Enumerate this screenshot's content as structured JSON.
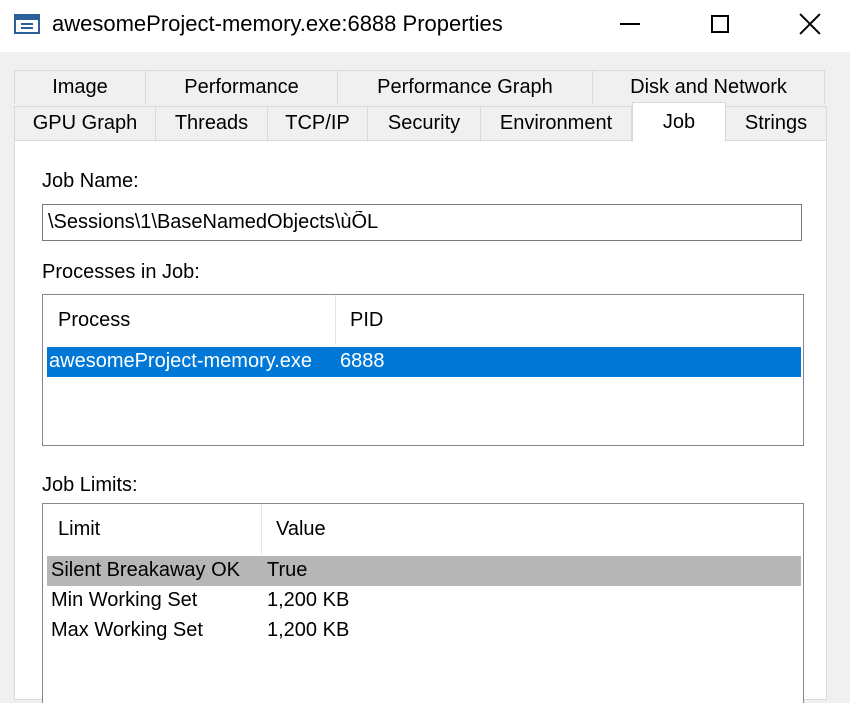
{
  "window": {
    "title": "awesomeProject-memory.exe:6888 Properties",
    "icon": "window-app-icon"
  },
  "tabs": {
    "row1": [
      {
        "label": "Image"
      },
      {
        "label": "Performance"
      },
      {
        "label": "Performance Graph"
      },
      {
        "label": "Disk and Network"
      }
    ],
    "row2": [
      {
        "label": "GPU Graph"
      },
      {
        "label": "Threads"
      },
      {
        "label": "TCP/IP"
      },
      {
        "label": "Security"
      },
      {
        "label": "Environment"
      },
      {
        "label": "Job",
        "active": true
      },
      {
        "label": "Strings"
      }
    ]
  },
  "job": {
    "name_label": "Job Name:",
    "name_value": "\\Sessions\\1\\BaseNamedObjects\\ùÕL",
    "processes_label": "Processes in Job:",
    "processes_columns": [
      "Process",
      "PID"
    ],
    "processes": [
      {
        "process": "awesomeProject-memory.exe",
        "pid": "6888",
        "selected": true
      }
    ],
    "limits_label": "Job Limits:",
    "limits_columns": [
      "Limit",
      "Value"
    ],
    "limits": [
      {
        "limit": "Silent Breakaway OK",
        "value": "True",
        "highlighted": true
      },
      {
        "limit": "Min Working Set",
        "value": "1,200 KB"
      },
      {
        "limit": "Max Working Set",
        "value": "1,200 KB"
      }
    ]
  },
  "colors": {
    "selection": "#0078d7",
    "inactive_selection": "#b6b6b6",
    "window_bg": "#f0f0f0"
  }
}
